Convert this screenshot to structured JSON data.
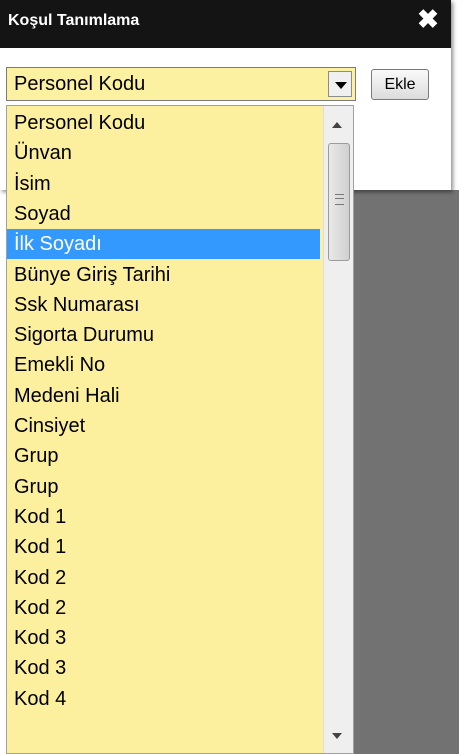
{
  "dialog": {
    "title": "Koşul Tanımlama",
    "close_icon": "close-icon"
  },
  "field_select": {
    "value": "Personel Kodu"
  },
  "add_button_label": "Ekle",
  "dropdown": {
    "selected_index": 4,
    "options": [
      "Personel Kodu",
      "Ünvan",
      "İsim",
      "Soyad",
      "İlk Soyadı",
      "Bünye Giriş Tarihi",
      "Ssk Numarası",
      "Sigorta Durumu",
      "Emekli No",
      "Medeni Hali",
      "Cinsiyet",
      "Grup",
      "Grup",
      "Kod 1",
      "Kod 1",
      "Kod 2",
      "Kod 2",
      "Kod 3",
      "Kod 3",
      "Kod 4"
    ]
  },
  "colors": {
    "titlebar": "#141414",
    "dropdown_bg": "#fcf09f",
    "selected_bg": "#3399ff",
    "backdrop_gray": "#727272"
  }
}
